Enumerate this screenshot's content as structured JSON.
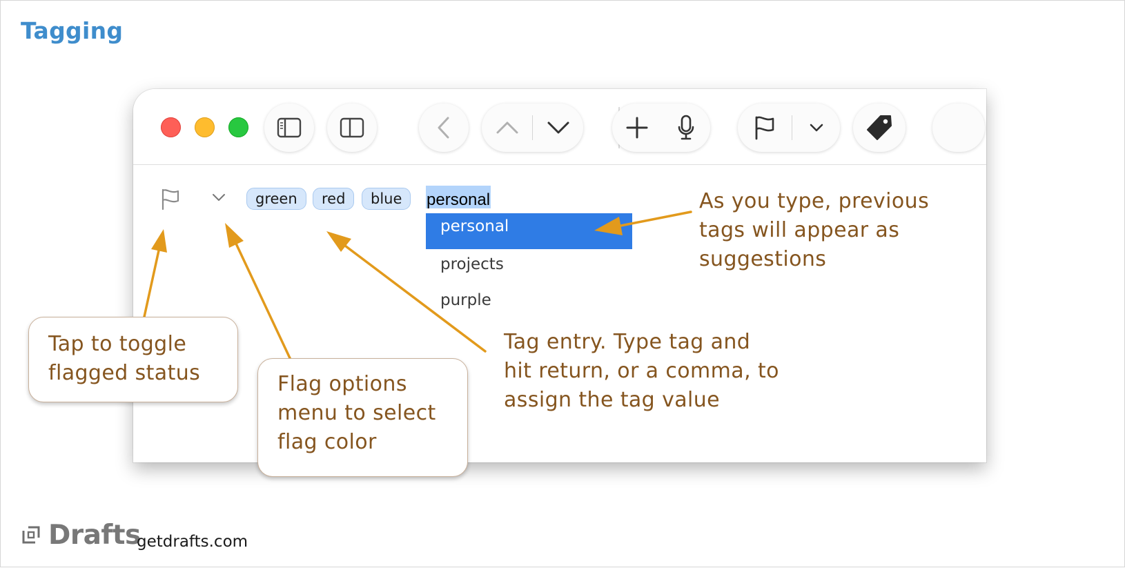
{
  "page": {
    "title": "Tagging"
  },
  "window": {
    "traffic_lights": [
      "close",
      "minimize",
      "zoom"
    ],
    "toolbar_icons": [
      "sidebar-left-icon",
      "sidebar-right-icon",
      "back-icon",
      "previous-draft-icon",
      "next-draft-icon",
      "new-draft-icon",
      "microphone-icon",
      "flag-icon",
      "chevron-down-icon",
      "tag-icon"
    ]
  },
  "editor": {
    "tags": [
      "green",
      "red",
      "blue"
    ],
    "tag_input_value": "personal",
    "suggestions": [
      {
        "label": "personal",
        "selected": true
      },
      {
        "label": "projects",
        "selected": false
      },
      {
        "label": "purple",
        "selected": false
      }
    ]
  },
  "callouts": {
    "suggestions": [
      "As you type, previous",
      "tags will appear as",
      "suggestions"
    ],
    "toggle": [
      "Tap to toggle",
      "flagged status"
    ],
    "flag_options": [
      "Flag options",
      "menu to select",
      "flag color"
    ],
    "tag_entry": [
      "Tag entry. Type tag and",
      "hit return, or a comma, to",
      "assign the tag value"
    ]
  },
  "footer": {
    "brand": "Drafts",
    "site": "getdrafts.com"
  },
  "colors": {
    "title": "#3f8dcc",
    "callout_text": "#85551f",
    "arrow": "#e29a1c",
    "selection": "#2f7ce5",
    "tag_chip": "#d6e7fb"
  }
}
